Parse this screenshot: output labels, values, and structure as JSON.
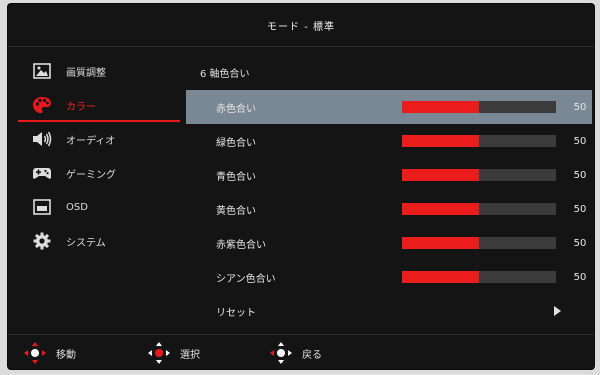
{
  "header": {
    "title": "モード - 標準"
  },
  "sidebar": {
    "items": [
      {
        "label": "画質調整",
        "icon": "picture-icon",
        "active": false
      },
      {
        "label": "カラー",
        "icon": "palette-icon",
        "active": true
      },
      {
        "label": "オーディオ",
        "icon": "speaker-icon",
        "active": false
      },
      {
        "label": "ゲーミング",
        "icon": "gamepad-icon",
        "active": false
      },
      {
        "label": "OSD",
        "icon": "osd-window-icon",
        "active": false
      },
      {
        "label": "システム",
        "icon": "gear-icon",
        "active": false
      }
    ]
  },
  "main": {
    "section_title": "6 軸色合い",
    "rows": [
      {
        "label": "赤色合い",
        "value": "50",
        "level": 0.5,
        "selected": true
      },
      {
        "label": "緑色合い",
        "value": "50",
        "level": 0.5,
        "selected": false
      },
      {
        "label": "青色合い",
        "value": "50",
        "level": 0.5,
        "selected": false
      },
      {
        "label": "黄色合い",
        "value": "50",
        "level": 0.5,
        "selected": false
      },
      {
        "label": "赤紫色合い",
        "value": "50",
        "level": 0.5,
        "selected": false
      },
      {
        "label": "シアン色合い",
        "value": "50",
        "level": 0.5,
        "selected": false
      }
    ],
    "reset_label": "リセット"
  },
  "footer": {
    "move_label": "移動",
    "select_label": "選択",
    "back_label": "戻る"
  },
  "colors": {
    "accent": "#e8181c",
    "selected_row": "#7a8895",
    "background": "#141414"
  }
}
